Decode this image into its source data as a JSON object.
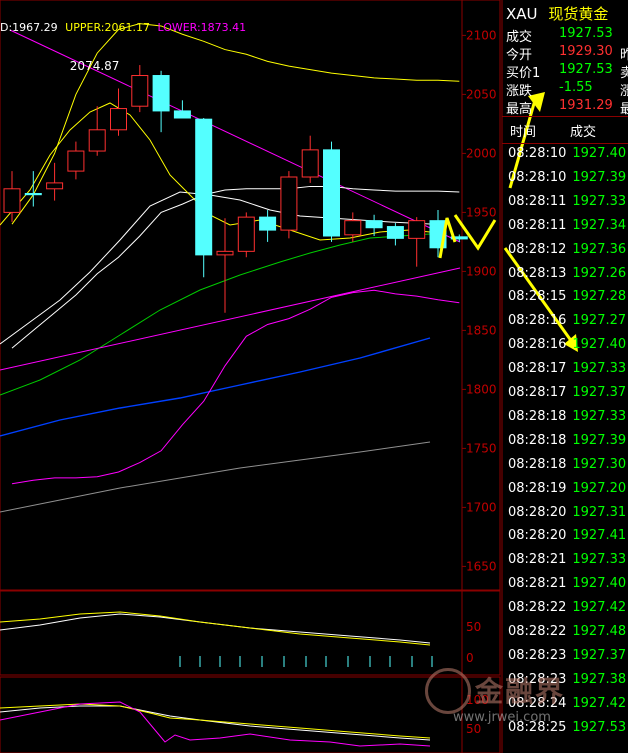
{
  "header": {
    "mid_text": "D:1967.29",
    "upper_text": "UPPER:2061.17",
    "lower_text": "LOWER:1873.41"
  },
  "quote": {
    "symbol": "XAU",
    "name": "现货黄金",
    "rows": [
      {
        "label": "成交",
        "value": "1927.53",
        "color": "#00ff00",
        "right_label": ""
      },
      {
        "label": "今开",
        "value": "1929.30",
        "color": "#ff3030",
        "right_label": "昨"
      },
      {
        "label": "买价1",
        "value": "1927.53",
        "color": "#00ff00",
        "right_label": "卖"
      },
      {
        "label": "涨跌",
        "value": "-1.55",
        "color": "#00ff00",
        "right_label": "涨"
      },
      {
        "label": "最高",
        "value": "1931.29",
        "color": "#ff3030",
        "right_label": "最"
      }
    ]
  },
  "ticks": {
    "header_time": "时间",
    "header_price": "成交",
    "rows": [
      {
        "time": "08:28:10",
        "price": "1927.40"
      },
      {
        "time": "08:28:10",
        "price": "1927.39"
      },
      {
        "time": "08:28:11",
        "price": "1927.33"
      },
      {
        "time": "08:28:11",
        "price": "1927.34"
      },
      {
        "time": "08:28:12",
        "price": "1927.36"
      },
      {
        "time": "08:28:13",
        "price": "1927.26"
      },
      {
        "time": "08:28:15",
        "price": "1927.28"
      },
      {
        "time": "08:28:16",
        "price": "1927.27"
      },
      {
        "time": "08:28:16",
        "price": "1927.40"
      },
      {
        "time": "08:28:17",
        "price": "1927.33"
      },
      {
        "time": "08:28:17",
        "price": "1927.37"
      },
      {
        "time": "08:28:18",
        "price": "1927.33"
      },
      {
        "time": "08:28:18",
        "price": "1927.39"
      },
      {
        "time": "08:28:18",
        "price": "1927.30"
      },
      {
        "time": "08:28:19",
        "price": "1927.20"
      },
      {
        "time": "08:28:20",
        "price": "1927.31"
      },
      {
        "time": "08:28:20",
        "price": "1927.41"
      },
      {
        "time": "08:28:21",
        "price": "1927.33"
      },
      {
        "time": "08:28:21",
        "price": "1927.40"
      },
      {
        "time": "08:28:22",
        "price": "1927.42"
      },
      {
        "time": "08:28:22",
        "price": "1927.48"
      },
      {
        "time": "08:28:23",
        "price": "1927.37"
      },
      {
        "time": "08:28:23",
        "price": "1927.38"
      },
      {
        "time": "08:28:24",
        "price": "1927.42"
      },
      {
        "time": "08:28:25",
        "price": "1927.53"
      }
    ]
  },
  "watermark": {
    "name": "金融界",
    "url": "www.jrwei.com"
  },
  "colors": {
    "up": "#ff3030",
    "down": "#54ffff",
    "grid": "#8b0000",
    "axis_text": "#c00000"
  },
  "chart_data": [
    {
      "type": "candlestick",
      "title": "",
      "ylim": [
        1630,
        2130
      ],
      "yticks": [
        2100,
        2050,
        2000,
        1950,
        1900,
        1850,
        1800,
        1750,
        1700,
        1650
      ],
      "annotations": [
        {
          "text": "2074.87",
          "candle": 6
        }
      ],
      "candles": [
        {
          "o": 1950,
          "h": 1985,
          "l": 1942,
          "c": 1970
        },
        {
          "o": 1966,
          "h": 1985,
          "l": 1955,
          "c": 1965
        },
        {
          "o": 1970,
          "h": 1992,
          "l": 1960,
          "c": 1975
        },
        {
          "o": 1985,
          "h": 2010,
          "l": 1978,
          "c": 2002
        },
        {
          "o": 2002,
          "h": 2040,
          "l": 1998,
          "c": 2020
        },
        {
          "o": 2020,
          "h": 2055,
          "l": 2015,
          "c": 2038
        },
        {
          "o": 2040,
          "h": 2074.87,
          "l": 2035,
          "c": 2066
        },
        {
          "o": 2066,
          "h": 2070,
          "l": 2018,
          "c": 2036
        },
        {
          "o": 2036,
          "h": 2045,
          "l": 2030,
          "c": 2030
        },
        {
          "o": 2029,
          "h": 2030,
          "l": 1895,
          "c": 1914
        },
        {
          "o": 1914,
          "h": 1945,
          "l": 1865,
          "c": 1917
        },
        {
          "o": 1917,
          "h": 1950,
          "l": 1912,
          "c": 1946
        },
        {
          "o": 1946,
          "h": 1952,
          "l": 1925,
          "c": 1935
        },
        {
          "o": 1935,
          "h": 1985,
          "l": 1928,
          "c": 1980
        },
        {
          "o": 1980,
          "h": 2015,
          "l": 1975,
          "c": 2003
        },
        {
          "o": 2003,
          "h": 2010,
          "l": 1925,
          "c": 1930
        },
        {
          "o": 1931,
          "h": 1950,
          "l": 1925,
          "c": 1943
        },
        {
          "o": 1943,
          "h": 1948,
          "l": 1930,
          "c": 1937
        },
        {
          "o": 1938,
          "h": 1941,
          "l": 1922,
          "c": 1928
        },
        {
          "o": 1928,
          "h": 1946,
          "l": 1904,
          "c": 1943
        },
        {
          "o": 1943,
          "h": 1952,
          "l": 1912,
          "c": 1920
        },
        {
          "o": 1929.3,
          "h": 1931.29,
          "l": 1925,
          "c": 1927.53
        }
      ],
      "series": [
        {
          "name": "UPPER",
          "color": "#ffff00",
          "values": [
            1940,
            1965,
            2000,
            2050,
            2085,
            2105,
            2110,
            2108,
            2101,
            2095,
            2088,
            2084,
            2078,
            2074,
            2071,
            2068,
            2066,
            2064,
            2063,
            2062,
            2062,
            2061.17
          ]
        },
        {
          "name": "MID",
          "color": "#ffffff",
          "values": [
            1835,
            1850,
            1865,
            1880,
            1898,
            1912,
            1930,
            1950,
            1957,
            1965,
            1969,
            1970,
            1970,
            1970,
            1972,
            1972,
            1970,
            1969,
            1968,
            1968,
            1968,
            1967.29
          ]
        },
        {
          "name": "LOWER",
          "color": "#ff00ff",
          "values": [
            1720,
            1723,
            1725,
            1725,
            1726,
            1730,
            1738,
            1748,
            1770,
            1790,
            1820,
            1845,
            1855,
            1860,
            1868,
            1878,
            1882,
            1884,
            1881,
            1879,
            1876,
            1873.41
          ]
        }
      ]
    }
  ]
}
